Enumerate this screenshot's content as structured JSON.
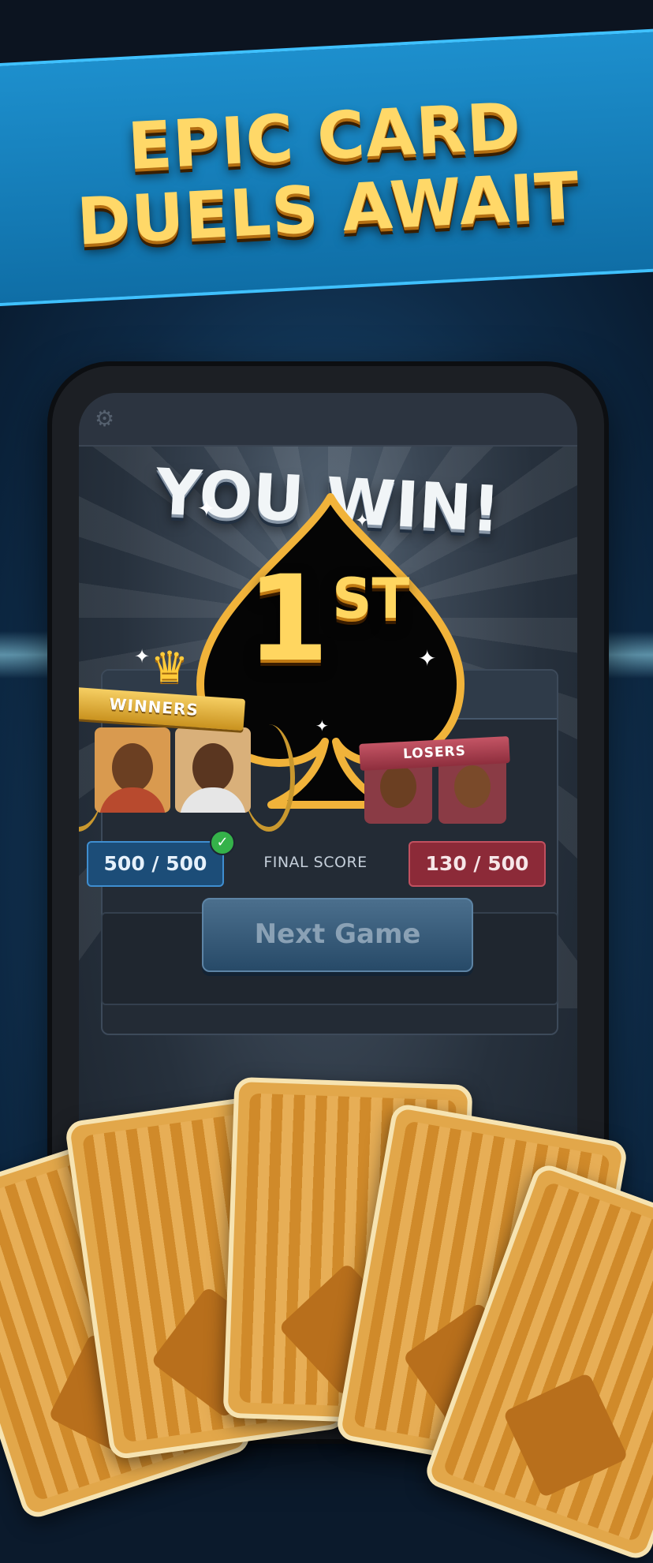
{
  "headline": {
    "line1": "EPIC CARD",
    "line2": "DUELS AWAIT"
  },
  "game": {
    "result_title": "YOU WIN!",
    "rank": {
      "number": "1",
      "suffix": "ST"
    },
    "winners_label": "WINNERS",
    "losers_label": "LOSERS",
    "winner_score": "500 / 500",
    "final_score_label": "FINAL SCORE",
    "loser_score": "130 / 500",
    "next_game_label": "Next Game"
  },
  "colors": {
    "gold": "#ffd660",
    "winner_blue": "#1c4d78",
    "loser_red": "#8c2a38",
    "check_green": "#35b24a"
  }
}
